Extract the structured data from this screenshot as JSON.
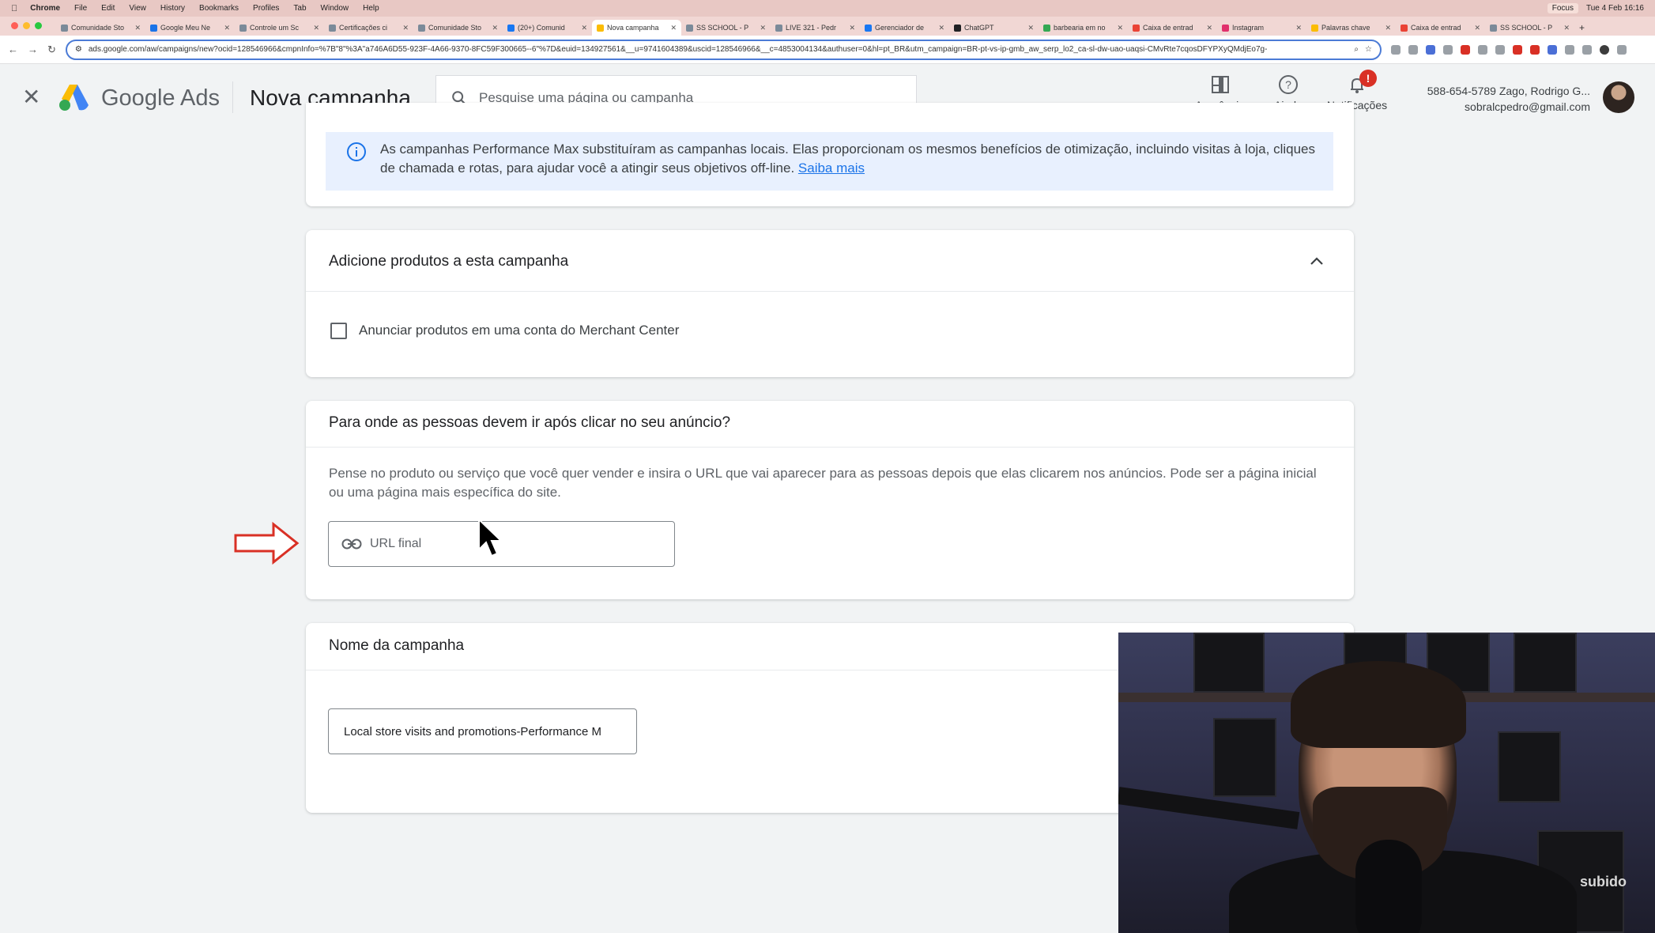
{
  "mac": {
    "app": "Chrome",
    "menus": [
      "Chrome",
      "File",
      "Edit",
      "View",
      "History",
      "Bookmarks",
      "Profiles",
      "Tab",
      "Window",
      "Help"
    ],
    "focus": "Focus",
    "clock": "Tue 4 Feb 16:16"
  },
  "tabs": [
    {
      "label": "Comunidade Sto",
      "active": false
    },
    {
      "label": "Google Meu Ne",
      "active": false
    },
    {
      "label": "Controle um Sc",
      "active": false
    },
    {
      "label": "Certificações ci",
      "active": false
    },
    {
      "label": "Comunidade Sto",
      "active": false
    },
    {
      "label": "(20+) Comunid",
      "active": false
    },
    {
      "label": "Nova campanha",
      "active": true
    },
    {
      "label": "SS SCHOOL - P",
      "active": false
    },
    {
      "label": "LIVE 321 - Pedr",
      "active": false
    },
    {
      "label": "Gerenciador de",
      "active": false
    },
    {
      "label": "ChatGPT",
      "active": false
    },
    {
      "label": "barbearia em no",
      "active": false
    },
    {
      "label": "Caixa de entrad",
      "active": false
    },
    {
      "label": "Instagram",
      "active": false
    },
    {
      "label": "Palavras chave",
      "active": false
    },
    {
      "label": "Caixa de entrad",
      "active": false
    },
    {
      "label": "SS SCHOOL - P",
      "active": false
    }
  ],
  "browser": {
    "url": "ads.google.com/aw/campaigns/new?ocid=128546966&cmpnInfo=%7B\"8\"%3A\"a746A6D55-923F-4A66-9370-8FC59F300665--6\"%7D&euid=134927561&__u=9741604389&uscid=128546966&__c=4853004134&authuser=0&hl=pt_BR&utm_campaign=BR-pt-vs-ip-gmb_aw_serp_lo2_ca-sl-dw-uao-uaqsi-CMvRte7cqosDFYPXyQMdjEo7g-"
  },
  "header": {
    "brand": "Google Ads",
    "page_title": "Nova campanha",
    "search_placeholder": "Pesquise uma página ou campanha",
    "appearance": "Aparência",
    "help": "Ajuda",
    "notifications": "Notificações",
    "notif_badge": "!",
    "account_line1": "588-654-5789 Zago, Rodrigo G...",
    "account_line2": "sobralcpedro@gmail.com"
  },
  "info": {
    "text": "As campanhas Performance Max substituíram as campanhas locais. Elas proporcionam os mesmos benefícios de otimização, incluindo visitas à loja, cliques de chamada e rotas, para ajudar você a atingir seus objetivos off-line.",
    "link": "Saiba mais"
  },
  "products": {
    "title": "Adicione produtos a esta campanha",
    "checkbox_label": "Anunciar produtos em uma conta do Merchant Center"
  },
  "destination": {
    "title": "Para onde as pessoas devem ir após clicar no seu anúncio?",
    "description": "Pense no produto ou serviço que você quer vender e insira o URL que vai aparecer para as pessoas depois que elas clicarem nos anúncios. Pode ser a página inicial ou uma página mais específica do site.",
    "url_placeholder": "URL final"
  },
  "campaign_name": {
    "title": "Nome da campanha",
    "value": "Local store visits and promotions-Performance M"
  },
  "webcam": {
    "watermark": "subido"
  },
  "colors": {
    "accent": "#1a73e8",
    "info_bg": "#e8f0fe",
    "arrow": "#d93025",
    "badge": "#d93025"
  }
}
